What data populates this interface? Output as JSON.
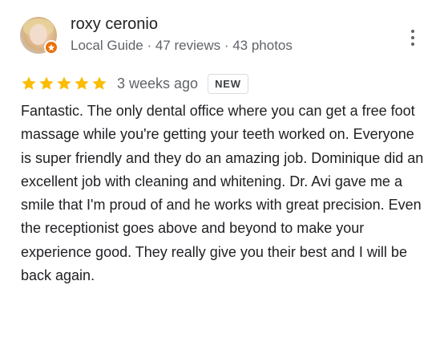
{
  "review": {
    "author_name": "roxy ceronio",
    "author_meta": "Local Guide · 47 reviews · 43 photos",
    "rating": 5,
    "rating_max": 5,
    "date": "3 weeks ago",
    "badge": "NEW",
    "text": "Fantastic. The only dental office where you can get a free foot massage while you're getting your teeth worked on. Everyone is super friendly and they do an amazing job. Dominique did an excellent job with cleaning and whitening. Dr. Avi gave me a smile that I'm proud of and he works with great precision. Even the receptionist goes above and beyond to make your experience good. They really give you their best and I will be back again."
  },
  "icons": {
    "star": "star-icon",
    "guide_badge": "local-guide-badge-icon",
    "more": "more-vert-icon"
  },
  "colors": {
    "star": "#fbbc04",
    "guide_badge": "#e8710a",
    "secondary_text": "#5f6368"
  }
}
